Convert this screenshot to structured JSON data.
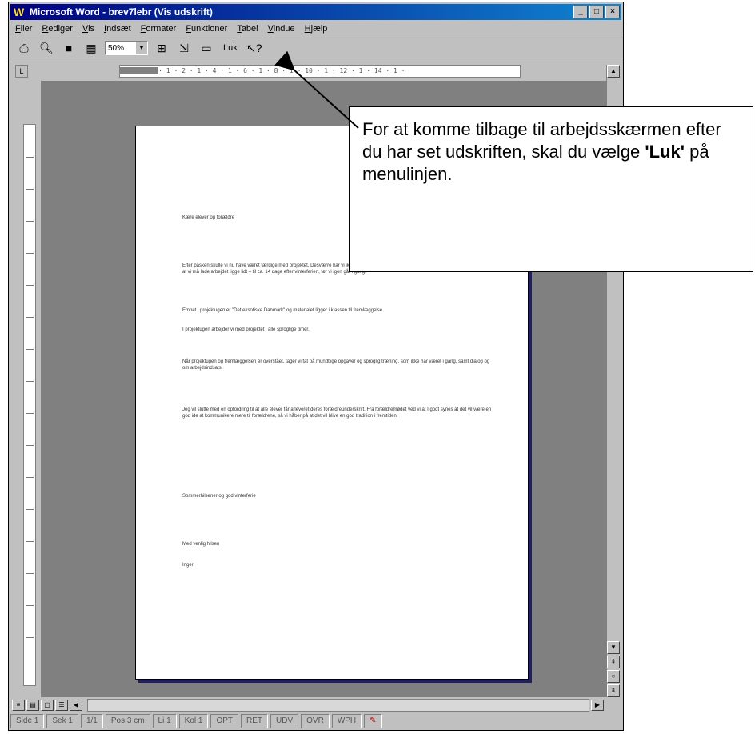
{
  "window": {
    "title": "Microsoft Word - brev7lebr (Vis udskrift)",
    "controls": [
      "_",
      "□",
      "×"
    ]
  },
  "menubar": {
    "items": [
      {
        "underline": "F",
        "rest": "iler"
      },
      {
        "underline": "R",
        "rest": "ediger"
      },
      {
        "underline": "V",
        "rest": "is"
      },
      {
        "underline": "I",
        "rest": "ndsæt"
      },
      {
        "underline": "F",
        "rest": "ormater"
      },
      {
        "underline": "F",
        "rest": "unktioner"
      },
      {
        "underline": "T",
        "rest": "abel"
      },
      {
        "underline": "V",
        "rest": "indue"
      },
      {
        "underline": "H",
        "rest": "jælp"
      }
    ]
  },
  "toolbar": {
    "zoom_value": "50%",
    "close_label": "Luk"
  },
  "ruler": {
    "marks": "· 1 · 2 · 1 · 4 · 1 · 6 · 1 · 8 · 1 · 10 · 1 · 12 · 1 · 14 · 1 ·"
  },
  "document": {
    "greeting": "Kære elever og forældre",
    "paragraphs": [
      "Efter påsken skulle vi nu have været færdige med projektet. Desværre har vi ikke kunnet nå det hele, da nogle elever har været syge. Det betyder, at vi må lade arbejdet ligge lidt – til ca. 14 dage efter vinterferien, før vi igen går i gang.",
      "Emnet i projektugen er \"Det eksotiske Danmark\" og materialet ligger i klassen til fremlæggelse.",
      "I projektugen arbejder vi med projektet i alle sproglige timer."
    ],
    "paragraph2": "Når projektugen og fremlæggelsen er overstået, tager vi fat på mundtlige opgaver og sproglig træning, som ikke har været i gang, samt dialog og om arbejdsindsats.",
    "paragraph3": "Jeg vil slutte med en opfordring til at alle elever får afleveret deres forældreunderskrift. Fra forældremødet ved vi at I godt synes at det vil være en god ide at kommunikere mere til forældrene, så vi håber på at det vil blive en god tradition i fremtiden.",
    "closing": "Sommerhilsener og god vinterferie",
    "signoff": "Med venlig hilsen",
    "signature": "Inger"
  },
  "statusbar": {
    "side": "Side 1",
    "sek": "Sek 1",
    "pages": "1/1",
    "pos": "Pos 3 cm",
    "line": "Li 1",
    "col": "Kol 1",
    "modes": [
      "OPT",
      "RET",
      "UDV",
      "OVR",
      "WPH"
    ]
  },
  "callout": {
    "text_before": "For at komme tilbage til arbejdsskærmen efter du har set udskriften, skal du vælge ",
    "bold": "'Luk'",
    "text_after": " på menulinjen."
  },
  "colors": {
    "titlebar": "#000080",
    "chrome": "#c0c0c0",
    "workspace": "#808080"
  }
}
